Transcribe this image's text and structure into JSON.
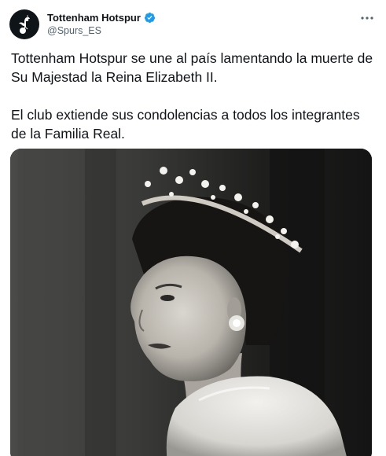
{
  "account": {
    "display_name": "Tottenham Hotspur",
    "handle": "@Spurs_ES",
    "verified": true,
    "avatar_icon": "cockerel-logo-icon"
  },
  "tweet": {
    "paragraphs": [
      "Tottenham Hotspur se une al país lamentando la muerte de Su Majestad la Reina Elizabeth II.",
      "El club extiende sus condolencias a todos los integrantes de la Familia Real."
    ]
  },
  "media": {
    "kind": "black-and-white-photo",
    "subject": "woman-wearing-tiara-and-fur-stole"
  },
  "colors": {
    "text_primary": "#0f1419",
    "text_secondary": "#536471",
    "verified_blue": "#1d9bf0",
    "avatar_bg": "#0f1419"
  }
}
